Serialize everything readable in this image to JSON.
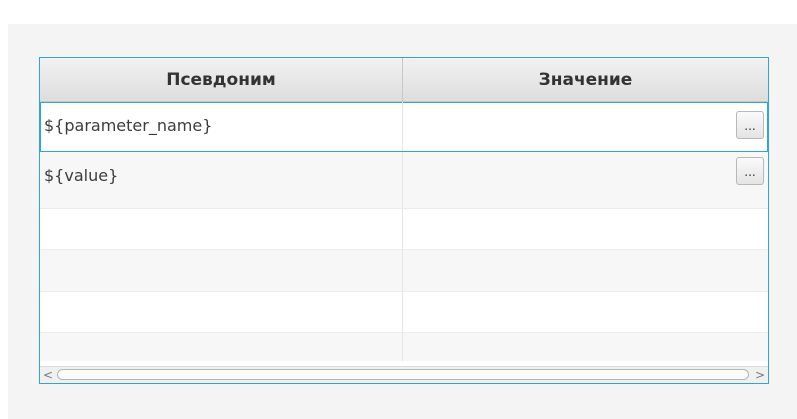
{
  "table": {
    "columns": [
      {
        "label": "Псевдоним"
      },
      {
        "label": "Значение"
      }
    ],
    "rows": [
      {
        "alias": "${parameter_name}",
        "value": "",
        "button_label": "...",
        "selected": true
      },
      {
        "alias": "${value}",
        "value": "",
        "button_label": "...",
        "selected": false
      }
    ],
    "empty_rows": 4
  },
  "scrollbar": {
    "left_arrow": "<",
    "right_arrow": ">"
  },
  "colors": {
    "accent": "#2fa6cf",
    "panel_bg": "#f4f4f4",
    "header_bg": "#e6e6e6"
  }
}
